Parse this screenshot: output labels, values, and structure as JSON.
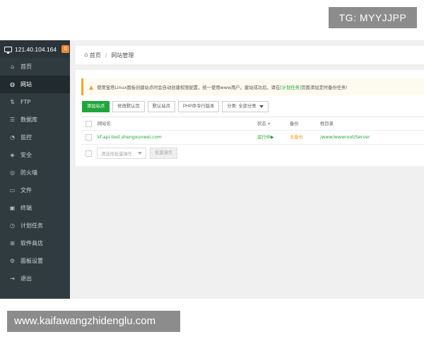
{
  "overlay": {
    "tg_label": "TG: MYYJJPP",
    "watermark": "www.kaifawangzhidenglu.com"
  },
  "sidebar": {
    "server_ip": "121.40.104.164",
    "server_badge": "0",
    "items": [
      {
        "label": "首页",
        "icon": "home-icon"
      },
      {
        "label": "网站",
        "icon": "globe-icon"
      },
      {
        "label": "FTP",
        "icon": "ftp-icon"
      },
      {
        "label": "数据库",
        "icon": "database-icon"
      },
      {
        "label": "监控",
        "icon": "monitor-icon"
      },
      {
        "label": "安全",
        "icon": "shield-icon"
      },
      {
        "label": "防火墙",
        "icon": "firewall-icon"
      },
      {
        "label": "文件",
        "icon": "folder-icon"
      },
      {
        "label": "终端",
        "icon": "terminal-icon"
      },
      {
        "label": "计划任务",
        "icon": "clock-icon"
      },
      {
        "label": "软件商店",
        "icon": "grid-icon"
      },
      {
        "label": "面板设置",
        "icon": "settings-icon"
      },
      {
        "label": "退出",
        "icon": "logout-icon"
      }
    ],
    "active_index": 1
  },
  "breadcrumb": {
    "home": "首页",
    "separator": "/",
    "current": "网站管理"
  },
  "notice": {
    "text_before": "使用宝塔Linux面板创建站点时会自动创建权限配置，统一使用www用户。建站成功后，请在",
    "link": "[计划任务]",
    "text_after": "页面添加定时备份任务!"
  },
  "toolbar": {
    "add_site": "添加站点",
    "edit_default_page": "修改默认页",
    "default_site": "默认站点",
    "php_cli_version": "PHP命令行版本",
    "category_select": "分类: 全部分类"
  },
  "table": {
    "headers": {
      "name": "网站名",
      "status": "状态",
      "backup": "备份",
      "root": "根目录"
    },
    "rows": [
      {
        "name": "kf-api-test.shengxunwei.com",
        "status": "运行中▶",
        "backup": "无备份",
        "root": "/www/wwwroot/Server"
      }
    ]
  },
  "batch": {
    "select_placeholder": "请选择批量操作",
    "action_button": "批量操作"
  },
  "colors": {
    "sidebar_bg": "#2f3b3f",
    "accent_green": "#20a53a",
    "warning_orange": "#f0a020"
  }
}
